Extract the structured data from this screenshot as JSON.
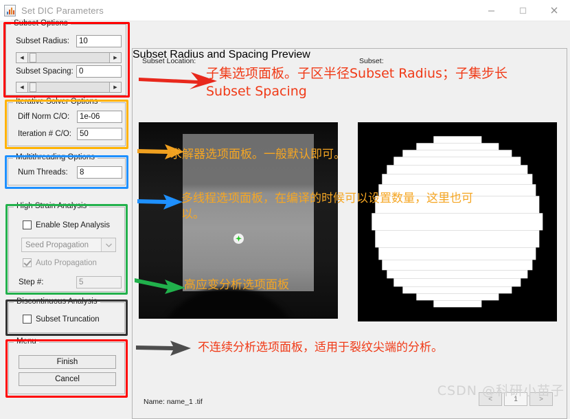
{
  "window": {
    "title": "Set DIC Parameters",
    "app_icon": "matlab-icon",
    "controls": {
      "minimize": "minimize-icon",
      "maximize": "maximize-icon",
      "close": "close-icon"
    }
  },
  "subset_options": {
    "title": "Subset Options",
    "radius_label": "Subset Radius:",
    "radius_value": "10",
    "spacing_label": "Subset Spacing:",
    "spacing_value": "0",
    "highlight_color": "#ff0000"
  },
  "iterative_solver": {
    "title": "Iterative Solver Options",
    "diff_norm_label": "Diff Norm C/O:",
    "diff_norm_value": "1e-06",
    "iteration_label": "Iteration # C/O:",
    "iteration_value": "50",
    "highlight_color": "#ffb200"
  },
  "multithreading": {
    "title": "Multithreading Options",
    "threads_label": "Num Threads:",
    "threads_value": "8",
    "highlight_color": "#1e90ff"
  },
  "high_strain": {
    "title": "High Strain Analysis",
    "enable_step_label": "Enable Step Analysis",
    "enable_step_checked": false,
    "propagation_value": "Seed Propagation",
    "auto_propagation_label": "Auto Propagation",
    "auto_propagation_checked": true,
    "step_label": "Step #:",
    "step_value": "5",
    "highlight_color": "#22b14c"
  },
  "discontinuous": {
    "title": "Discontinuous Analysis",
    "truncation_label": "Subset Truncation",
    "truncation_checked": false,
    "highlight_color": "#333333"
  },
  "menu": {
    "title": "Menu",
    "finish_label": "Finish",
    "cancel_label": "Cancel",
    "highlight_color": "#ff0000"
  },
  "preview": {
    "title": "Subset Radius and Spacing Preview",
    "left_caption": "Subset Location:",
    "right_caption": "Subset:",
    "name_label": "Name: name_1 .tif",
    "nav": {
      "prev": "<",
      "page": "1",
      "next": ">"
    }
  },
  "annotations": [
    {
      "id": "subset-options-note",
      "text": "子集选项面板。子区半径Subset Radius；子集步长\nSubset Spacing",
      "color": "#f03a17",
      "arrow_color": "#e8281c",
      "font_size": 19
    },
    {
      "id": "solver-note",
      "text": "求解器选项面板。一般默认即可。",
      "color": "#f5a623",
      "arrow_color": "#f0a020",
      "font_size": 17
    },
    {
      "id": "multithreading-note",
      "text": "多线程选项面板，在编译的时候可以设置数量，这里也可\n以。",
      "color": "#f5a623",
      "arrow_color": "#1e90ff",
      "font_size": 17
    },
    {
      "id": "high-strain-note",
      "text": "高应变分析选项面板",
      "color": "#f5a623",
      "arrow_color": "#21b14c",
      "font_size": 17
    },
    {
      "id": "discontinuous-note",
      "text": "不连续分析选项面板，适用于裂纹尖端的分析。",
      "color": "#f03a17",
      "arrow_color": "#4d4d4d",
      "font_size": 17
    }
  ],
  "watermark": {
    "text": "CSDN @科研小苗子"
  }
}
